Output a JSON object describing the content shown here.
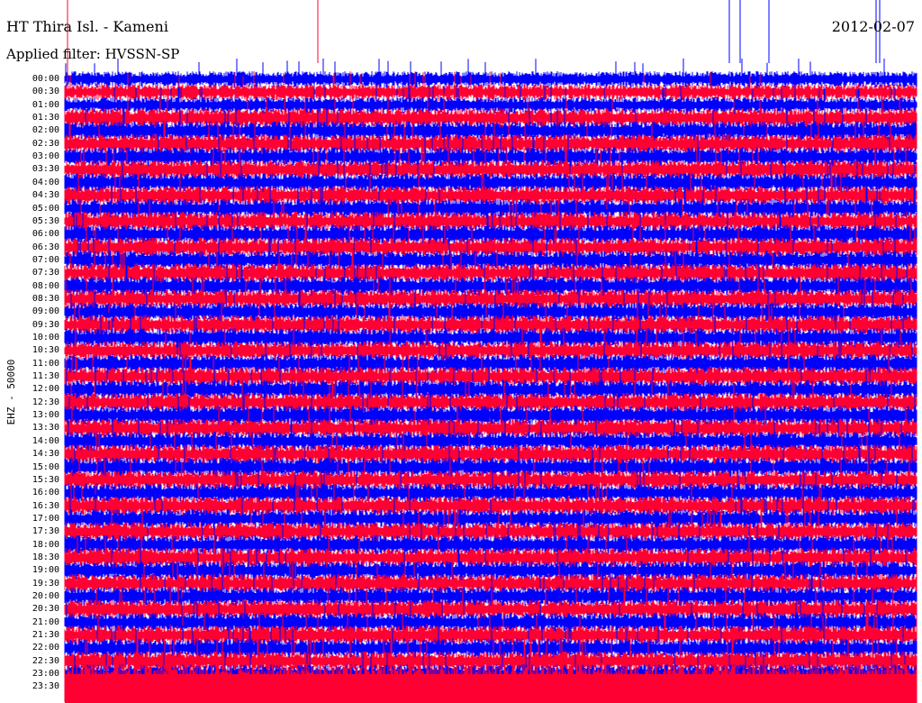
{
  "header": {
    "station": "HT Thira Isl. - Kameni",
    "date": "2012-02-07",
    "filter": "Applied filter: HVSSN-SP",
    "channel": "EHZ - 50000"
  },
  "chart_data": {
    "type": "helicorder",
    "title": "HT Thira Isl. - Kameni",
    "date": "2012-02-07",
    "ylabel": "EHZ - 50000",
    "trace_colors": [
      "#0000ff",
      "#ff0033"
    ],
    "row_labels": [
      "00:00",
      "00:30",
      "01:00",
      "01:30",
      "02:00",
      "02:30",
      "03:00",
      "03:30",
      "04:00",
      "04:30",
      "05:00",
      "05:30",
      "06:00",
      "06:30",
      "07:00",
      "07:30",
      "08:00",
      "08:30",
      "09:00",
      "09:30",
      "10:00",
      "10:30",
      "11:00",
      "11:30",
      "12:00",
      "12:30",
      "13:00",
      "13:30",
      "14:00",
      "14:30",
      "15:00",
      "15:30",
      "16:00",
      "16:30",
      "17:00",
      "17:30",
      "18:00",
      "18:30",
      "19:00",
      "19:30",
      "20:00",
      "20:30",
      "21:00",
      "21:30",
      "22:00",
      "22:30",
      "23:00",
      "23:30"
    ]
  }
}
